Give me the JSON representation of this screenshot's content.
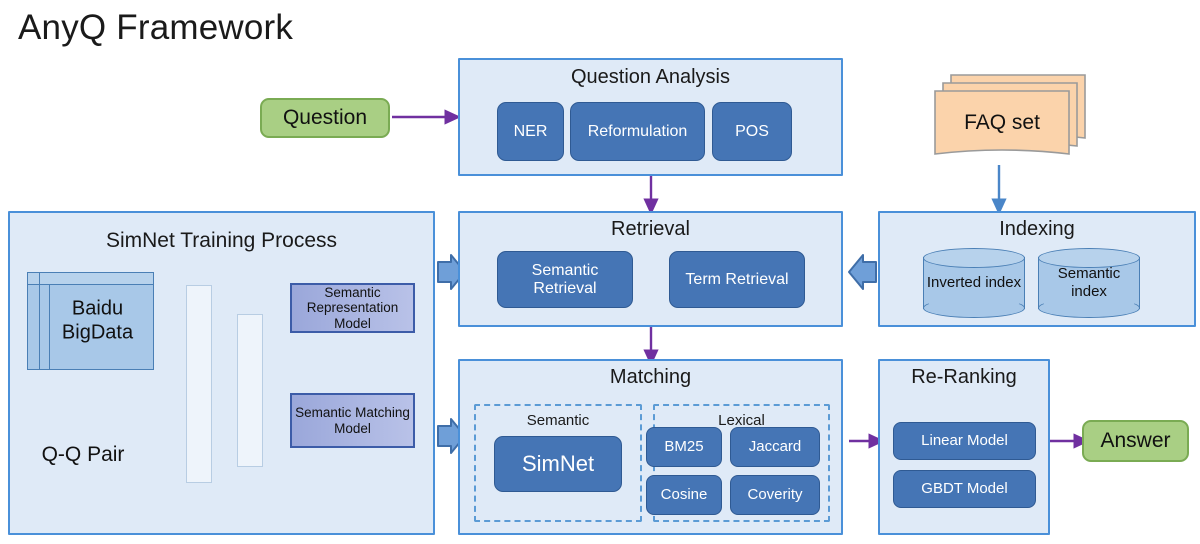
{
  "title": "AnyQ Framework",
  "question_node": {
    "label": "Question"
  },
  "answer_node": {
    "label": "Answer"
  },
  "question_analysis": {
    "title": "Question Analysis",
    "items": [
      "NER",
      "Reformulation",
      "POS"
    ]
  },
  "faq": {
    "label": "FAQ set"
  },
  "indexing": {
    "title": "Indexing",
    "indexes": [
      "Inverted index",
      "Semantic index"
    ]
  },
  "retrieval": {
    "title": "Retrieval",
    "items": [
      "Semantic Retrieval",
      "Term Retrieval"
    ]
  },
  "matching": {
    "title": "Matching",
    "semantic": {
      "label": "Semantic",
      "items": [
        "SimNet"
      ]
    },
    "lexical": {
      "label": "Lexical",
      "items": [
        "BM25",
        "Jaccard",
        "Cosine",
        "Coverity"
      ]
    }
  },
  "reranking": {
    "title": "Re-Ranking",
    "items": [
      "Linear Model",
      "GBDT Model"
    ]
  },
  "simnet_training": {
    "title": "SimNet Training Process",
    "sources": [
      {
        "label": "Baidu BigData"
      },
      {
        "label": "Q-Q Pair"
      }
    ],
    "outputs": [
      "Semantic Representation Model",
      "Semantic Matching Model"
    ]
  },
  "colors": {
    "panel_fill": "#dfeaf7",
    "panel_border": "#4a90d9",
    "chip_fill": "#4575b5",
    "green_fill": "#a9cf84",
    "green_border": "#7aab53",
    "orange_fill": "#fbd3ab",
    "orange_border": "#9a9a9a",
    "purple_arrow": "#7030a0",
    "blue_arrow": "#4a86c8",
    "gray_arrow": "#a6a6a6",
    "model_border": "#3c5ca8",
    "cylinder_fill": "#a8c8e8",
    "dashed_border": "#5b9bd5"
  }
}
